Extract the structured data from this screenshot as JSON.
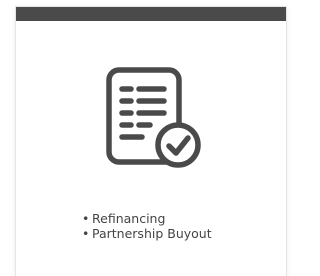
{
  "card": {
    "icon": "document-checkmark-icon",
    "items": [
      {
        "label": "Refinancing"
      },
      {
        "label": "Partnership Buyout"
      }
    ]
  },
  "colors": {
    "topbar": "#4a4a4a",
    "icon": "#4a4a4a",
    "text": "#444444"
  }
}
